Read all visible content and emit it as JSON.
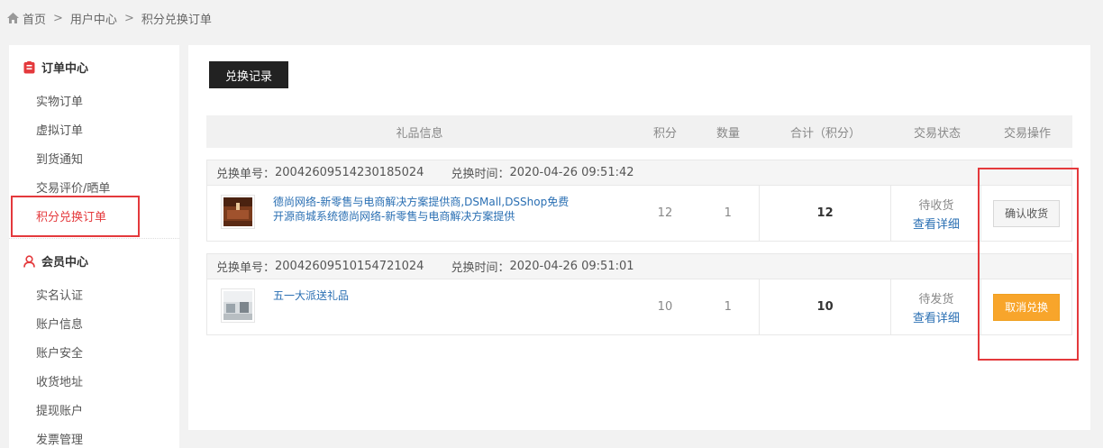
{
  "breadcrumb": {
    "home": "首页",
    "sep1": ">",
    "user_center": "用户中心",
    "sep2": ">",
    "current": "积分兑换订单"
  },
  "sidebar": {
    "order_center": {
      "title": "订单中心",
      "items": [
        "实物订单",
        "虚拟订单",
        "到货通知",
        "交易评价/晒单",
        "积分兑换订单"
      ]
    },
    "member_center": {
      "title": "会员中心",
      "items": [
        "实名认证",
        "账户信息",
        "账户安全",
        "收货地址",
        "提现账户",
        "发票管理"
      ]
    }
  },
  "main": {
    "tab_label": "兑换记录",
    "columns": [
      "礼品信息",
      "积分",
      "数量",
      "合计（积分）",
      "交易状态",
      "交易操作"
    ],
    "orders": [
      {
        "no_label": "兑换单号：",
        "no": "20042609514230185024",
        "time_label": "兑换时间：",
        "time": "2020-04-26 09:51:42",
        "gift_name": "德尚网络-新零售与电商解决方案提供商,DSMall,DSShop免费开源商城系统德尚网络-新零售与电商解决方案提供",
        "points": "12",
        "qty": "1",
        "total": "12",
        "status": "待收货",
        "detail": "查看详细",
        "op": "确认收货"
      },
      {
        "no_label": "兑换单号：",
        "no": "20042609510154721024",
        "time_label": "兑换时间：",
        "time": "2020-04-26 09:51:01",
        "gift_name": "五一大派送礼品",
        "points": "10",
        "qty": "1",
        "total": "10",
        "status": "待发货",
        "detail": "查看详细",
        "op": "取消兑换"
      }
    ]
  },
  "colors": {
    "accent_red": "#e4393c",
    "link_blue": "#2a6fb3",
    "cancel_orange": "#f8a52b"
  }
}
